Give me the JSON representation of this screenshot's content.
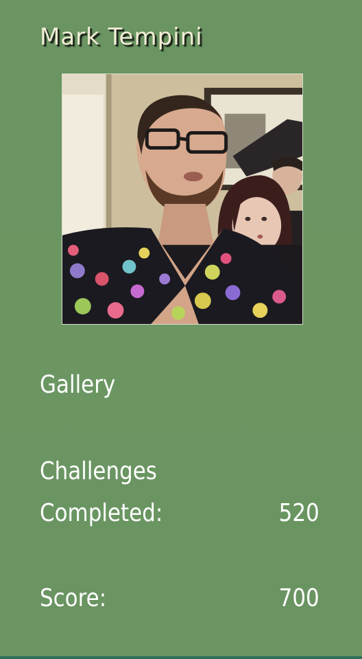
{
  "profile": {
    "name": "Mark Tempini",
    "photo_description_icon": "profile-photo"
  },
  "menu": {
    "gallery_label": "Gallery"
  },
  "stats": {
    "challenges_label_line1": "Challenges",
    "challenges_label_line2": "Completed:",
    "challenges_value": "520",
    "score_label": "Score:",
    "score_value": "700"
  },
  "colors": {
    "background": "#6b9562",
    "name_text": "#f2eed6",
    "name_shadow": "#1f2a1c",
    "body_text": "#ffffff",
    "bottom_strip": "#2f6e5c"
  }
}
